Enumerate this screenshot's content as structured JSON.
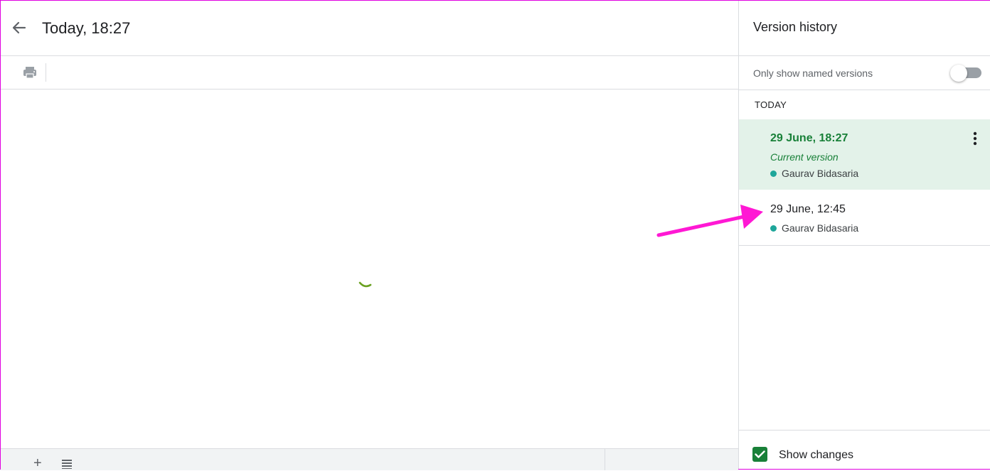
{
  "main": {
    "title": "Today, 18:27",
    "icons": {
      "back": "arrow-back-icon",
      "print": "printer-icon",
      "loading": "loading-spinner-icon"
    }
  },
  "bottom_bar": {
    "add_sheet_label": "+",
    "icons": {
      "all_sheets": "list-icon"
    }
  },
  "panel": {
    "title": "Version history",
    "named_toggle": {
      "label": "Only show named versions",
      "checked": false
    },
    "section_label": "TODAY",
    "versions": [
      {
        "time": "29 June, 18:27",
        "subtitle": "Current version",
        "author": "Gaurav Bidasaria",
        "selected": true
      },
      {
        "time": "29 June, 12:45",
        "author": "Gaurav Bidasaria",
        "selected": false
      }
    ],
    "show_changes": {
      "label": "Show changes",
      "checked": true
    }
  },
  "colors": {
    "accent_green": "#188038",
    "selected_bg": "#e3f2e9",
    "author_dot": "#1ea69a",
    "annotation_arrow": "#ff18d4",
    "spinner": "#6aa121"
  }
}
